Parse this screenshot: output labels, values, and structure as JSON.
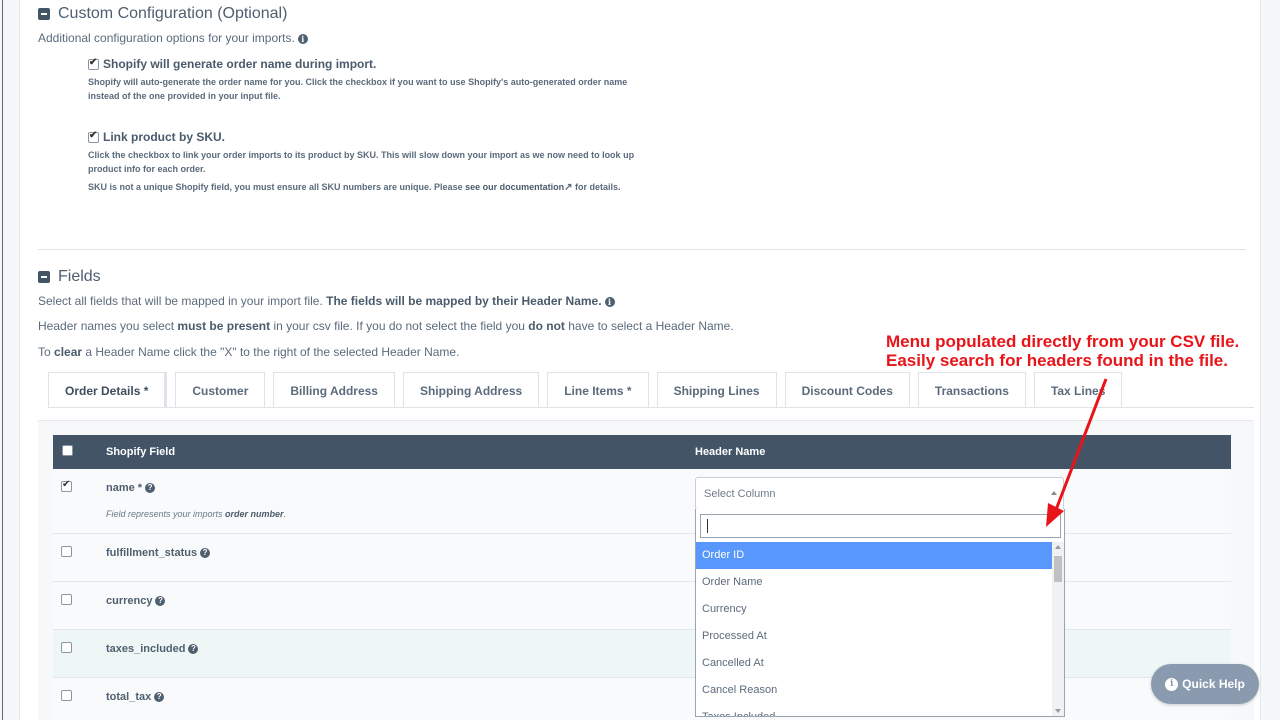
{
  "custom_config": {
    "title": "Custom Configuration (Optional)",
    "subtitle": "Additional configuration options for your imports.",
    "option1": {
      "label": "Shopify will generate order name during import.",
      "desc": "Shopify will auto-generate the order name for you. Click the checkbox if you want to use Shopify's auto-generated order name instead of the one provided in your input file."
    },
    "option2": {
      "label": "Link product by SKU.",
      "desc1": "Click the checkbox to link your order imports to its product by SKU. This will slow down your import as we now need to look up product info for each order.",
      "desc2_prefix": "SKU is not a unique Shopify field, you must ensure all SKU numbers are unique. Please ",
      "desc2_link": "see our documentation",
      "desc2_suffix": " for details."
    }
  },
  "fields": {
    "title": "Fields",
    "line1_a": "Select all fields that will be mapped in your import file. ",
    "line1_b": "The fields will be mapped by their Header Name.",
    "line2_a": "Header names you select ",
    "line2_b": "must be present",
    "line2_c": " in your csv file. If you do not select the field you ",
    "line2_d": "do not",
    "line2_e": " have to select a Header Name.",
    "line3_a": "To ",
    "line3_b": "clear",
    "line3_c": " a Header Name click the \"X\" to the right of the selected Header Name."
  },
  "tabs": [
    "Order Details *",
    "Customer",
    "Billing Address",
    "Shipping Address",
    "Line Items *",
    "Shipping Lines",
    "Discount Codes",
    "Transactions",
    "Tax Lines"
  ],
  "table": {
    "col_field": "Shopify Field",
    "col_header": "Header Name",
    "rows": [
      {
        "name": "name *",
        "note_a": "Field represents your imports ",
        "note_b": "order number",
        "note_c": "."
      },
      {
        "name": "fulfillment_status"
      },
      {
        "name": "currency"
      },
      {
        "name": "taxes_included"
      },
      {
        "name": "total_tax"
      }
    ]
  },
  "select": {
    "placeholder": "Select Column",
    "options": [
      "Order ID",
      "Order Name",
      "Currency",
      "Processed At",
      "Cancelled At",
      "Cancel Reason",
      "Taxes Included"
    ]
  },
  "callout": {
    "line1": "Menu populated directly from your CSV file.",
    "line2": "Easily search for headers found in the file."
  },
  "quick_help": "Quick Help",
  "colors": {
    "header_bg": "#425466",
    "highlight": "#5897fb",
    "callout": "#e8141a",
    "quick_help": "#8a9bb0"
  }
}
